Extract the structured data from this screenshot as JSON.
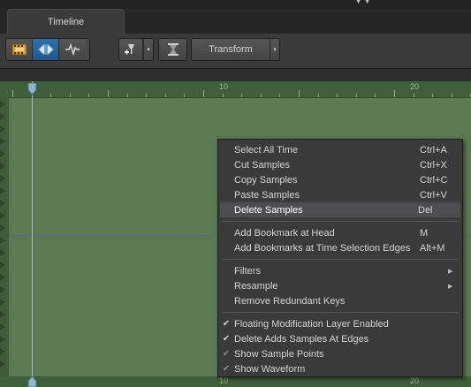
{
  "tab": {
    "label": "Timeline"
  },
  "toolbar": {
    "transform_label": "Transform"
  },
  "ruler": {
    "labels": [
      "10",
      "20"
    ]
  },
  "menu": {
    "items": [
      {
        "label": "Select All Time",
        "shortcut": "Ctrl+A"
      },
      {
        "label": "Cut Samples",
        "shortcut": "Ctrl+X"
      },
      {
        "label": "Copy Samples",
        "shortcut": "Ctrl+C"
      },
      {
        "label": "Paste Samples",
        "shortcut": "Ctrl+V"
      },
      {
        "label": "Delete Samples",
        "shortcut": "Del",
        "highlighted": true
      },
      {
        "label": "Add Bookmark at Head",
        "shortcut": "M"
      },
      {
        "label": "Add Bookmarks at Time Selection Edges",
        "shortcut": "Alt+M"
      },
      {
        "label": "Filters",
        "submenu": true
      },
      {
        "label": "Resample",
        "submenu": true
      },
      {
        "label": "Remove Redundant Keys"
      },
      {
        "label": "Floating Modification Layer Enabled",
        "checked": true
      },
      {
        "label": "Delete Adds Samples At Edges",
        "checked": true
      },
      {
        "label": "Show Sample Points",
        "checked": true,
        "dim": true
      },
      {
        "label": "Show Waveform",
        "checked": true,
        "dim": true
      }
    ]
  },
  "colors": {
    "track": "#5b7a53",
    "highlight": "#4d4d52",
    "accent": "#2f6fa8"
  }
}
